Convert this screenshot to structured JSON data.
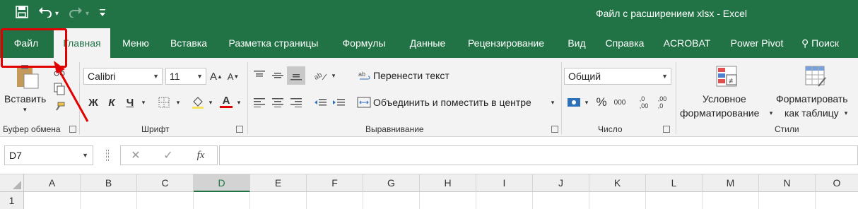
{
  "window_title": "Файл с расширением xlsx  -  Excel",
  "qat": {
    "save": "💾",
    "undo": "↶",
    "undo_dd": "▾",
    "redo": "↷",
    "redo_dd": "▾",
    "customize": "≡"
  },
  "tabs": [
    "Файл",
    "Главная",
    "Меню",
    "Вставка",
    "Разметка страницы",
    "Формулы",
    "Данные",
    "Рецензирование",
    "Вид",
    "Справка",
    "ACROBAT",
    "Power Pivot"
  ],
  "active_tab": "Главная",
  "search_label": "⚲ Поиск",
  "ribbon": {
    "clipboard": {
      "paste_label": "Вставить",
      "paste_dd": "▾",
      "group_label": "Буфер обмена"
    },
    "font": {
      "font_name": "Calibri",
      "font_size": "11",
      "grow": "A",
      "shrink": "A",
      "bold": "Ж",
      "italic": "К",
      "underline": "Ч",
      "group_label": "Шрифт",
      "font_color": "A"
    },
    "alignment": {
      "wrap_text": "Перенести текст",
      "merge_center": "Объединить и поместить в центре",
      "group_label": "Выравнивание"
    },
    "number": {
      "format": "Общий",
      "percent": "%",
      "comma": "000",
      "inc_dec": ",0\n,00",
      "dec_dec": ",00\n,0",
      "group_label": "Число"
    },
    "styles": {
      "cond_format_1": "Условное",
      "cond_format_2": "форматирование",
      "format_table_1": "Форматировать",
      "format_table_2": "как таблицу",
      "group_label": "Стили"
    }
  },
  "formula_bar": {
    "name_box": "D7",
    "cancel": "✕",
    "enter": "✓",
    "fx": "fx",
    "formula": ""
  },
  "columns": [
    "A",
    "B",
    "C",
    "D",
    "E",
    "F",
    "G",
    "H",
    "I",
    "J",
    "K",
    "L",
    "M",
    "N",
    "O"
  ],
  "selected_column": "D",
  "rows": [
    "1"
  ],
  "colors": {
    "excel_green": "#217346",
    "highlight_red": "#e00000"
  }
}
